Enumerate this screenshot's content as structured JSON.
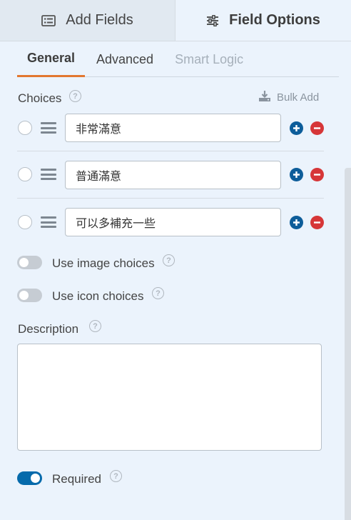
{
  "top_tabs": [
    {
      "label": "Add Fields",
      "icon": "form-list-icon",
      "active": false
    },
    {
      "label": "Field Options",
      "icon": "sliders-icon",
      "active": true
    }
  ],
  "sub_tabs": [
    {
      "label": "General",
      "active": true
    },
    {
      "label": "Advanced",
      "active": false
    },
    {
      "label": "Smart Logic",
      "active": false,
      "disabled": true
    }
  ],
  "choices": {
    "label": "Choices",
    "bulk_add_label": "Bulk Add",
    "items": [
      {
        "value": "非常滿意"
      },
      {
        "value": "普通滿意"
      },
      {
        "value": "可以多補充一些"
      }
    ]
  },
  "options": {
    "use_image_choices": {
      "label": "Use image choices",
      "enabled": false
    },
    "use_icon_choices": {
      "label": "Use icon choices",
      "enabled": false
    },
    "required": {
      "label": "Required",
      "enabled": true
    }
  },
  "description": {
    "label": "Description",
    "value": ""
  },
  "colors": {
    "accent_orange": "#e27730",
    "add_blue": "#0d5d9a",
    "remove_red": "#d63638",
    "toggle_on": "#056aab",
    "background": "#ebf3fc"
  }
}
